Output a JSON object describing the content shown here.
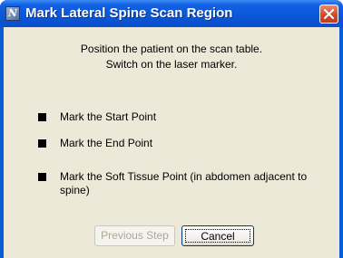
{
  "window": {
    "title": "Mark Lateral Spine Scan Region",
    "icon": "app-icon",
    "close_icon": "close-icon"
  },
  "instructions": {
    "line1": "Position the patient on the scan table.",
    "line2": "Switch on the laser marker."
  },
  "steps": [
    {
      "label": "Mark the Start Point"
    },
    {
      "label": "Mark the End Point"
    },
    {
      "label": "Mark the Soft Tissue Point (in abdomen adjacent to spine)"
    }
  ],
  "buttons": {
    "previous": {
      "label": "Previous Step",
      "enabled": false
    },
    "cancel": {
      "label": "Cancel",
      "enabled": true
    }
  },
  "colors": {
    "title_bar": "#0a57d8",
    "close_button": "#d4472a",
    "dialog_background": "#ece9d8"
  }
}
